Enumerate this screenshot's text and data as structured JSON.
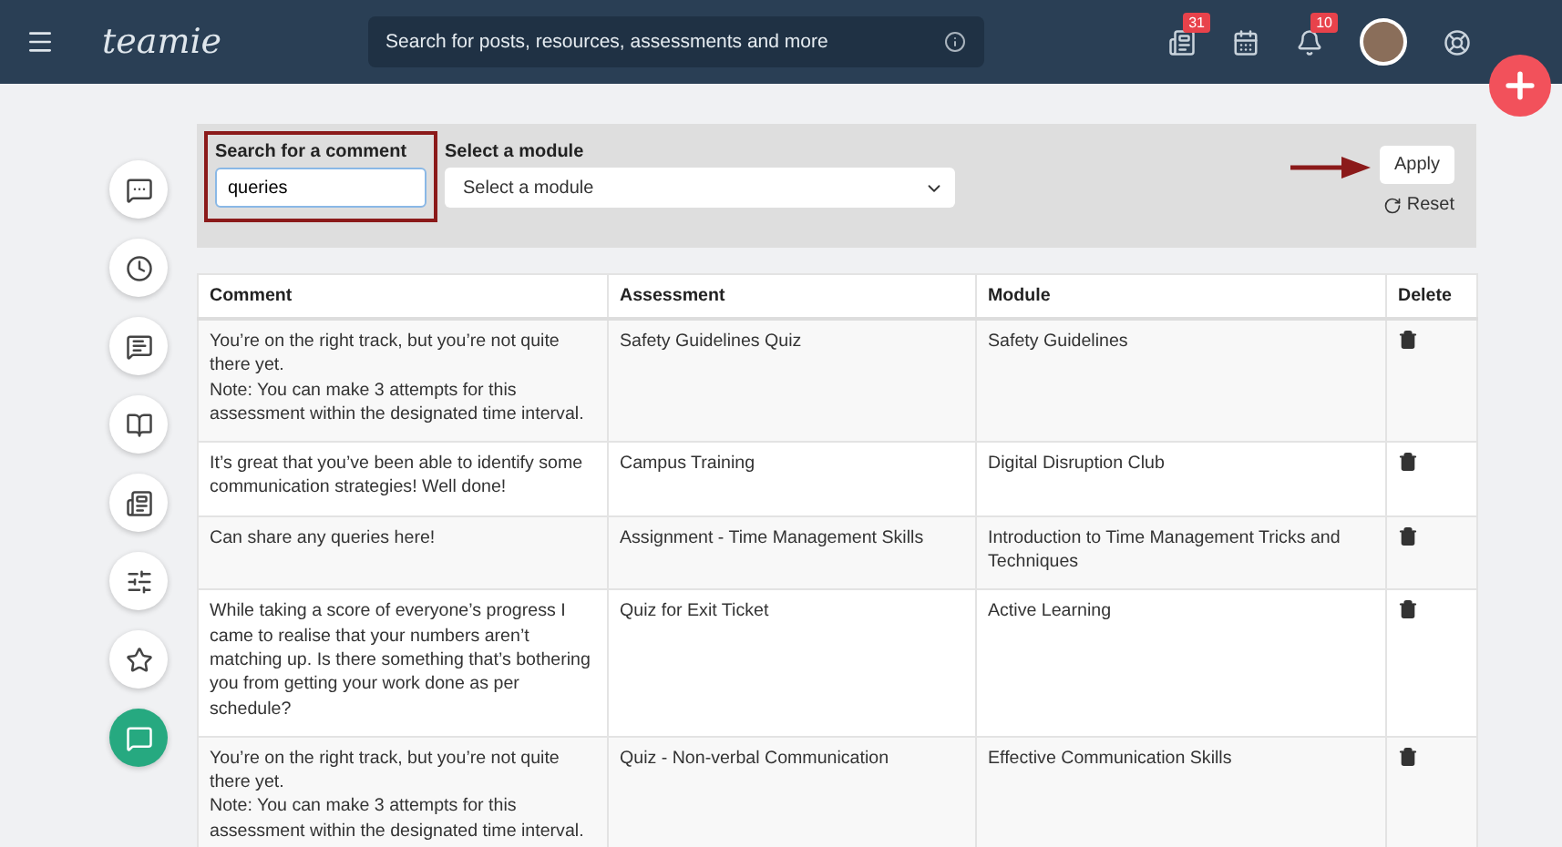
{
  "header": {
    "logo": "teamie",
    "search_placeholder": "Search for posts, resources, assessments and more",
    "badges": [
      {
        "kind": "posts",
        "count": "31"
      },
      {
        "kind": "calendar"
      },
      {
        "kind": "bell",
        "count": "10"
      },
      {
        "kind": "avatar"
      },
      {
        "kind": "help"
      }
    ]
  },
  "sidebar": {
    "items": [
      {
        "kind": "chat",
        "selected": false
      },
      {
        "kind": "clock",
        "selected": false
      },
      {
        "kind": "comment",
        "selected": false
      },
      {
        "kind": "book",
        "selected": false
      },
      {
        "kind": "news",
        "selected": false
      },
      {
        "kind": "sliders",
        "selected": false
      },
      {
        "kind": "star",
        "selected": false
      },
      {
        "kind": "message",
        "selected": true
      }
    ]
  },
  "filters": {
    "search_label": "Search for a comment",
    "search_value": "queries",
    "module_label": "Select a module",
    "module_value": "Select a module",
    "apply": "Apply",
    "reset": "Reset"
  },
  "table": {
    "columns": [
      "Comment",
      "Assessment",
      "Module",
      "Delete"
    ],
    "rows": [
      {
        "comment": "You’re on the right track, but you’re not quite there yet.\nNote: You can make 3 attempts for this assessment within the designated time interval.",
        "assessment": "Safety Guidelines Quiz",
        "module": "Safety Guidelines"
      },
      {
        "comment": "It’s great that you’ve been able to identify some communication strategies! Well done!",
        "assessment": "Campus Training",
        "module": "Digital Disruption Club"
      },
      {
        "comment": "Can share any queries here!",
        "assessment": "Assignment - Time Management Skills",
        "module": "Introduction to Time Management Tricks and Techniques"
      },
      {
        "comment": "While taking a score of everyone’s progress I came to realise that your numbers aren’t matching up. Is there something that’s bothering you from getting your work done as per schedule?",
        "assessment": "Quiz for Exit Ticket",
        "module": "Active Learning"
      },
      {
        "comment": "You’re on the right track, but you’re not quite there yet.\nNote: You can make 3 attempts for this assessment within the designated time interval.",
        "assessment": "Quiz - Non-verbal Communication",
        "module": "Effective Communication Skills"
      }
    ]
  }
}
